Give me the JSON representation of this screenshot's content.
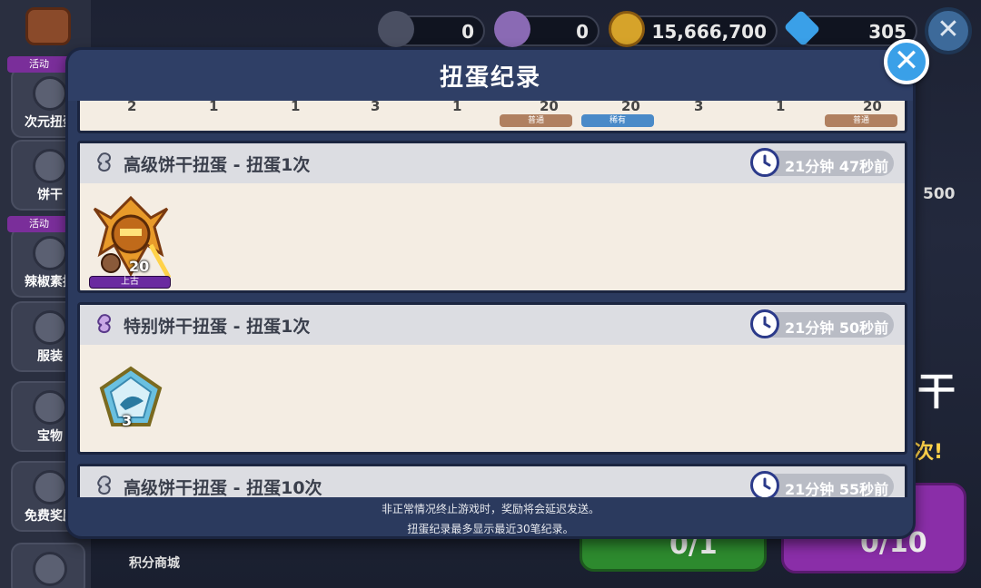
{
  "background": {
    "sidebar": [
      {
        "label": "次元扭蛋",
        "tag": "活动"
      },
      {
        "label": "饼干",
        "tag": ""
      },
      {
        "label": "辣椒素扭",
        "tag": "活动"
      },
      {
        "label": "服装",
        "tag": ""
      },
      {
        "label": "宝物",
        "tag": ""
      },
      {
        "label": "免费奖励",
        "tag": ""
      }
    ],
    "currencies": [
      {
        "icon": "soulstone-dark-icon",
        "value": "0"
      },
      {
        "icon": "soulstone-purple-icon",
        "value": "0"
      },
      {
        "icon": "coin-icon",
        "value": "15,666,700"
      },
      {
        "icon": "crystal-icon",
        "value": "305"
      }
    ],
    "right_text_500": "500",
    "right_text_big": "干",
    "right_text_times": "次!",
    "green_button_label": "0/1",
    "purple_button_label": "0/10",
    "points_shop_label": "积分商城",
    "top_close_glyph": "✕"
  },
  "modal": {
    "title": "扭蛋纪录",
    "close_glyph": "✕",
    "partial_numbers": [
      "2",
      "1",
      "1",
      "3",
      "1",
      "20",
      "20",
      "3",
      "1",
      "20"
    ],
    "partial_badges": [
      "普通",
      "稀有",
      "普通"
    ],
    "records": [
      {
        "icon": "cookie-gacha-icon",
        "title": "高级饼干扭蛋 - 扭蛋1次",
        "time": "21分钟 47秒前",
        "item": {
          "type": "cookie-portrait",
          "count": "20",
          "rarity": "上古"
        }
      },
      {
        "icon": "special-gacha-icon",
        "title": "特别饼干扭蛋 - 扭蛋1次",
        "time": "21分钟 50秒前",
        "item": {
          "type": "crystal-gem",
          "count": "3",
          "rarity": ""
        }
      },
      {
        "icon": "cookie-gacha-icon",
        "title": "高级饼干扭蛋 - 扭蛋10次",
        "time": "21分钟 55秒前",
        "item": null
      }
    ],
    "footer": [
      "非正常情况终止游戏时，奖励将会延迟发送。",
      "扭蛋纪录最多显示最近30笔纪录。"
    ]
  },
  "colors": {
    "modal_bg": "#2b3a5e",
    "card_bg": "#f4ede3",
    "header_bg": "#dcdde2",
    "close_blue": "#3aa0e8",
    "rarity_ancient": "#6a2aa0"
  }
}
